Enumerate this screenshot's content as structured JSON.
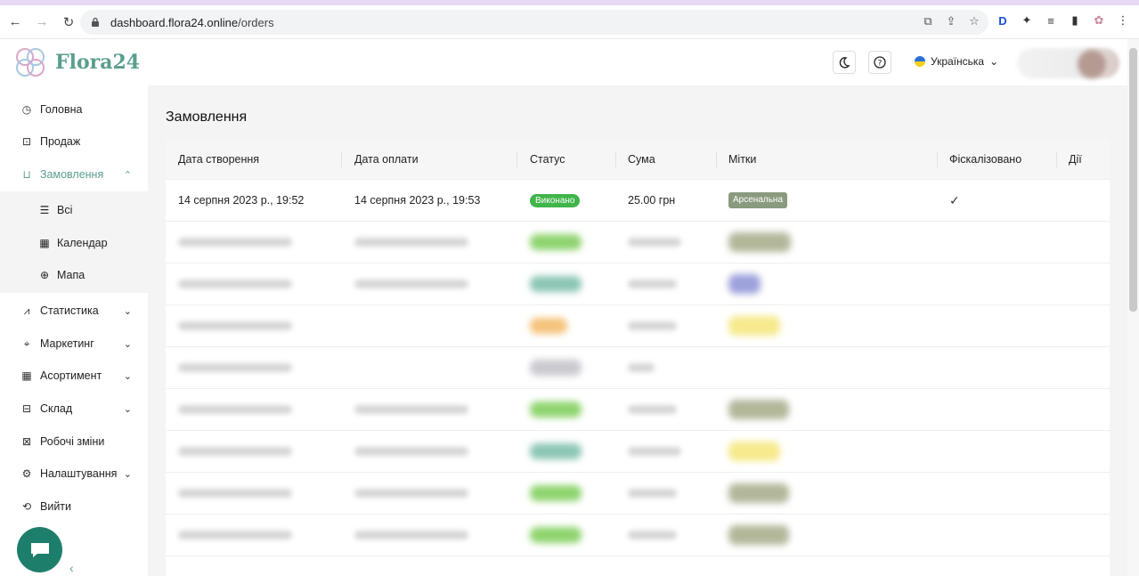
{
  "browser": {
    "url_host": "dashboard.flora24.online",
    "url_path": "/orders"
  },
  "header": {
    "logo_text": "Flora24",
    "language": "Українська"
  },
  "sidebar": {
    "items": [
      {
        "label": "Головна",
        "icon": "dashboard-icon"
      },
      {
        "label": "Продаж",
        "icon": "sale-icon"
      },
      {
        "label": "Замовлення",
        "icon": "bag-icon"
      },
      {
        "label": "Статистика",
        "icon": "chart-icon"
      },
      {
        "label": "Маркетинг",
        "icon": "target-icon"
      },
      {
        "label": "Асортимент",
        "icon": "grid-icon"
      },
      {
        "label": "Склад",
        "icon": "warehouse-icon"
      },
      {
        "label": "Робочі зміни",
        "icon": "shift-icon"
      },
      {
        "label": "Налаштування",
        "icon": "gear-icon"
      },
      {
        "label": "Вийти",
        "icon": "logout-icon"
      }
    ],
    "submenu": [
      {
        "label": "Всі",
        "icon": "list-icon"
      },
      {
        "label": "Календар",
        "icon": "calendar-icon"
      },
      {
        "label": "Мапа",
        "icon": "globe-icon"
      }
    ]
  },
  "main": {
    "title": "Замовлення",
    "columns": [
      "Дата створення",
      "Дата оплати",
      "Статус",
      "Сума",
      "Мітки",
      "Фіскалізовано",
      "Дії"
    ],
    "rows": [
      {
        "created": "14 серпня 2023 р., 19:52",
        "paid": "14 серпня 2023 р., 19:53",
        "status": "Виконано",
        "sum": "25.00 грн",
        "tag": "Арсенальна",
        "fiscalized": "✓"
      }
    ]
  },
  "colors": {
    "brand": "#5a9e8e",
    "status_done": "#3fb54a",
    "tag": "#8a9a7e",
    "chat": "#1d7e6b"
  }
}
